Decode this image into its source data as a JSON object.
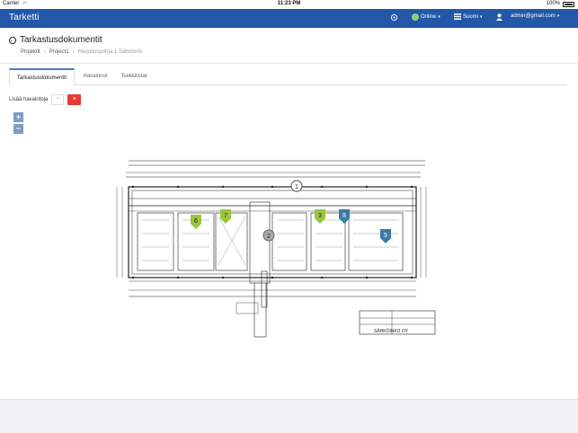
{
  "statusbar": {
    "carrier": "Carrier",
    "time": "11:23 PM",
    "battery": "100%"
  },
  "navbar": {
    "brand": "Tarketti",
    "status": "Online",
    "language": "Suomi",
    "user": "admin@gmail.com",
    "icons": [
      "settings-icon",
      "globe-icon",
      "language-icon",
      "user-icon"
    ]
  },
  "page": {
    "title": "Tarkastusdokumentit",
    "breadcrumb": [
      "Projektit",
      "Project1",
      "Harjoituspohja 1 Sähköinfo"
    ]
  },
  "tabs": [
    "Tarkastusdokumentit",
    "Havainnot",
    "Tsekkilistat"
  ],
  "add_observation": {
    "label": "Lisää havaintoja",
    "cancel": "×"
  },
  "zoom": {
    "in": "+",
    "out": "−"
  },
  "floorplan": {
    "company": "SÄHKÖINFO OY",
    "pins": [
      {
        "label": "1",
        "color": "#888888"
      },
      {
        "label": "2",
        "color": "#888888"
      },
      {
        "label": "3",
        "color": "#9bc53d"
      },
      {
        "label": "6",
        "color": "#9bc53d"
      },
      {
        "label": "7",
        "color": "#9bc53d"
      },
      {
        "label": "8",
        "color": "#3a7ca5"
      },
      {
        "label": "5",
        "color": "#3a7ca5"
      }
    ],
    "colors": {
      "accent": "#2357a8",
      "danger": "#e53935"
    }
  }
}
